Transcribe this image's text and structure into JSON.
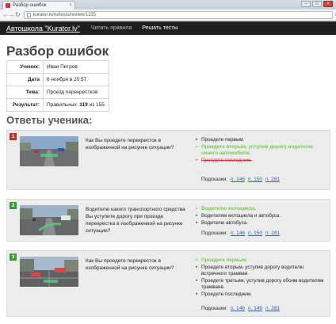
{
  "browser": {
    "tab_title": "Разбор ошибок",
    "tab_close": "×",
    "url": "kurator.lv/ru/tests/review/1155",
    "controls": {
      "minimize": "–",
      "maximize": "□",
      "close": "×"
    },
    "nav": {
      "back": "←",
      "forward": "→",
      "reload": "↻",
      "menu": "≡"
    }
  },
  "header": {
    "brand": "Автошкола \"Kurator.lv\"",
    "menu": [
      "Читать правила",
      "Решать тесты"
    ]
  },
  "page_title": "Разбор ошибок",
  "info": [
    {
      "key": "Ученик:",
      "value": "Иван Петров"
    },
    {
      "key": "Дата",
      "value": "6 ноября в 20:57"
    },
    {
      "key": "Тема:",
      "value": "Проезд перекрестков"
    },
    {
      "key": "Результат:",
      "value_prefix": "Правильных:",
      "value_bold": "119",
      "value_suffix": "из 155"
    }
  ],
  "answers_title": "Ответы ученика:",
  "hints_label": "Подсказки:",
  "questions": [
    {
      "number": "1",
      "status": "wrong",
      "question": "Как Вы проедете перекресток в изображенной на рисунке ситуации?",
      "answers": [
        {
          "text": "Проедете первым.",
          "state": "normal"
        },
        {
          "text": "Проедете вторым, уступив дорогу водителю синего автомобиля.",
          "state": "correct"
        },
        {
          "text": "Проедете последним.",
          "state": "wrong"
        }
      ],
      "hints": [
        "п. 146",
        "п. 150",
        "п. 281"
      ]
    },
    {
      "number": "2",
      "status": "right",
      "question": "Водителю какого транспортного средства Вы уступите дорогу при проезде перекрестка в изображенной на рисунке ситуации?",
      "answers": [
        {
          "text": "Водителю мотоцикла.",
          "state": "correct"
        },
        {
          "text": "Водителям мотоцикла и автобуса.",
          "state": "normal"
        },
        {
          "text": "Водителю автобуса.",
          "state": "normal"
        }
      ],
      "hints": [
        "п. 146",
        "п. 150",
        "п. 281"
      ]
    },
    {
      "number": "3",
      "status": "right",
      "question": "Как Вы проедете перекресток в изображенной на рисунке ситуации?",
      "answers": [
        {
          "text": "Проедете первым.",
          "state": "correct"
        },
        {
          "text": "Проедете вторым, уступив дорогу водителю встречного трамвая.",
          "state": "normal"
        },
        {
          "text": "Проедете третьим, уступив дорогу обоим водителям трамваев.",
          "state": "normal"
        },
        {
          "text": "Проедете последним.",
          "state": "normal"
        }
      ],
      "hints": [
        "п. 146",
        "п. 149",
        "п. 281"
      ]
    }
  ],
  "colors": {
    "header_bg": "#1f1f1f",
    "wrong": "#c0312a",
    "right": "#3c9a33",
    "correct_answer": "#78c850",
    "link": "#2a5db0"
  }
}
